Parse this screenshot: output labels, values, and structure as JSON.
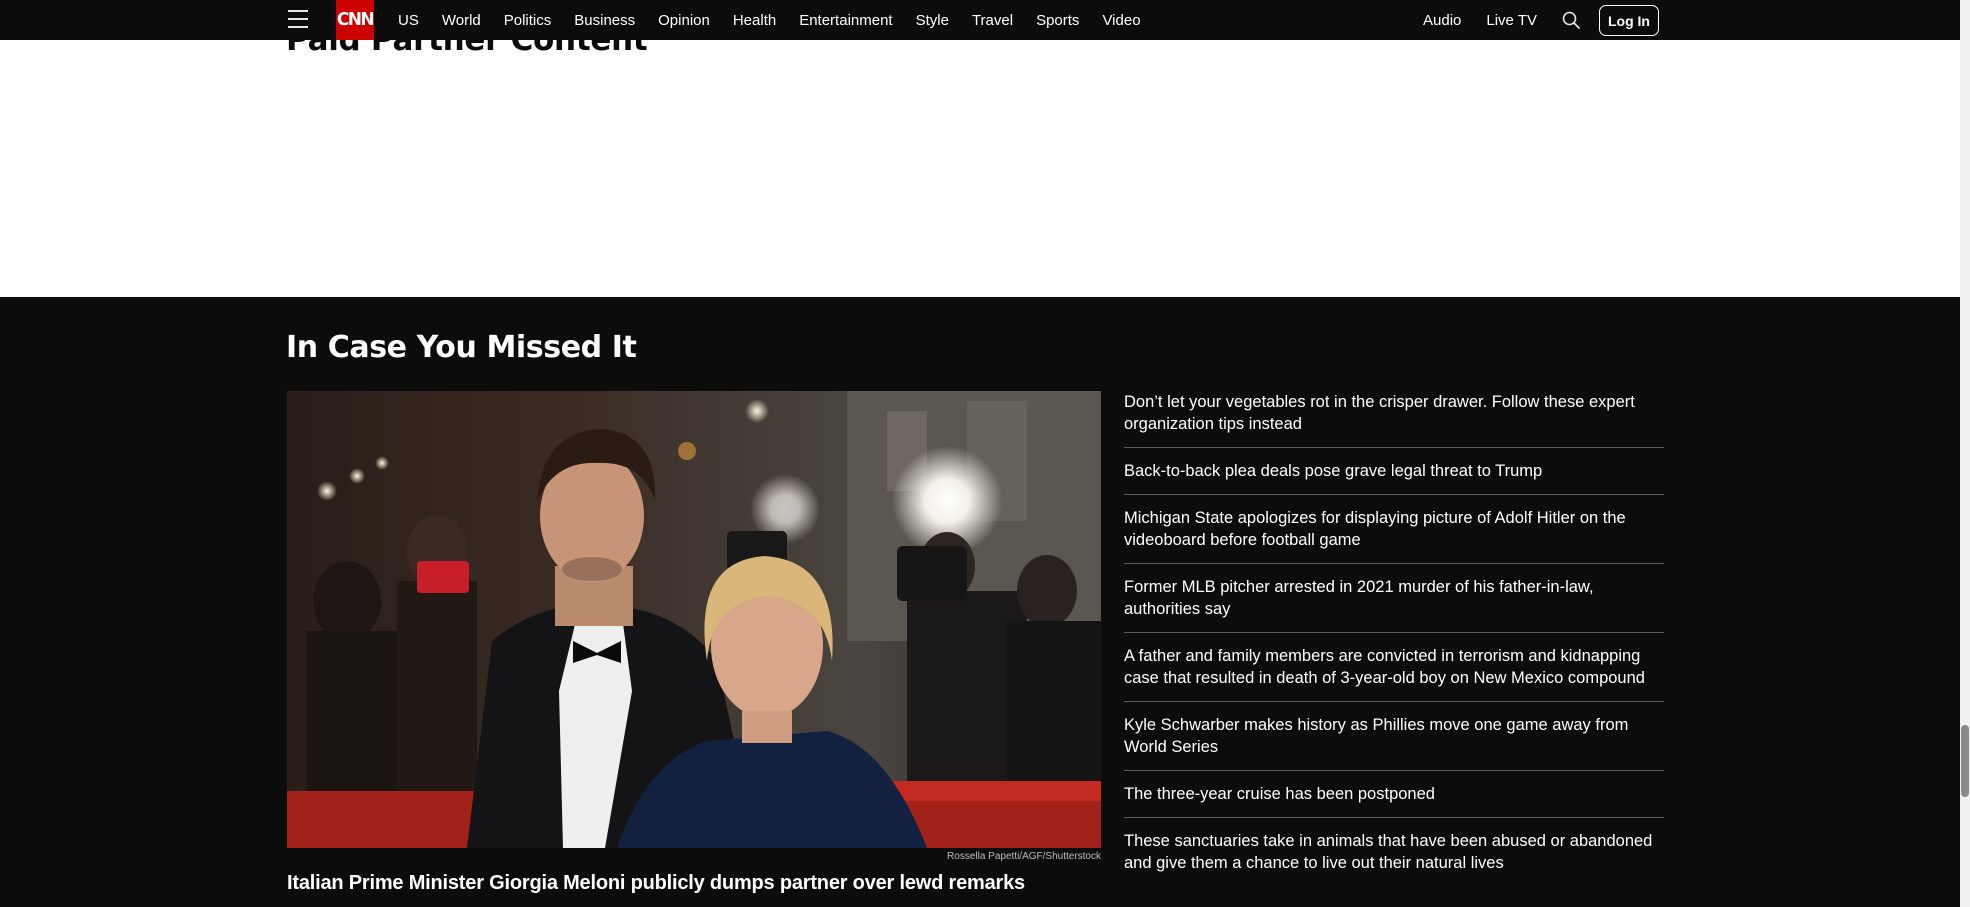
{
  "nav": {
    "logo": "CNN",
    "links": [
      "US",
      "World",
      "Politics",
      "Business",
      "Opinion",
      "Health",
      "Entertainment",
      "Style",
      "Travel",
      "Sports",
      "Video"
    ],
    "right_links": [
      "Audio",
      "Live TV"
    ],
    "login_label": "Log In"
  },
  "partner": {
    "title": "Paid Partner Content"
  },
  "icymi": {
    "title": "In Case You Missed It",
    "hero": {
      "credit": "Rossella Papetti/AGF/Shutterstock",
      "headline": "Italian Prime Minister Giorgia Meloni publicly dumps partner over lewd remarks"
    },
    "stories": [
      "Don’t let your vegetables rot in the crisper drawer. Follow these expert organization tips instead",
      "Back-to-back plea deals pose grave legal threat to Trump",
      "Michigan State apologizes for displaying picture of Adolf Hitler on the videoboard before football game",
      "Former MLB pitcher arrested in 2021 murder of his father-in-law, authorities say",
      "A father and family members are convicted in terrorism and kidnapping case that resulted in death of 3-year-old boy on New Mexico compound",
      "Kyle Schwarber makes history as Phillies move one game away from World Series",
      "The three-year cruise has been postponed",
      "These sanctuaries take in animals that have been abused or abandoned and give them a chance to live out their natural lives"
    ]
  },
  "colors": {
    "brand_red": "#cc0000",
    "background_dark": "#0c0c0c",
    "text_light": "#ffffff"
  },
  "icons": [
    "menu-icon",
    "search-icon"
  ]
}
